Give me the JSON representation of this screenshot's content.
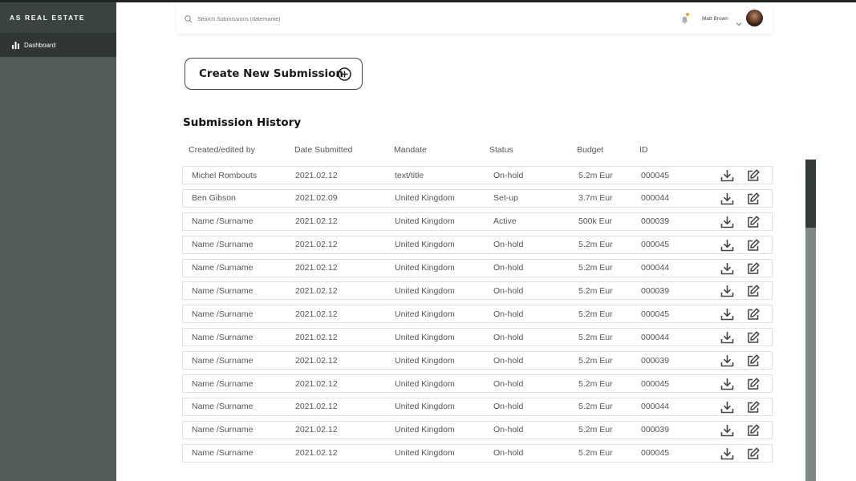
{
  "sidebar": {
    "brand": "AS REAL ESTATE",
    "items": [
      {
        "label": "Dashboard",
        "icon": "bar-chart-icon"
      }
    ]
  },
  "header": {
    "search_placeholder": "Search Submissions (date/name)",
    "user_name": "Matt Brown",
    "notification_dot_color": "#f0a030"
  },
  "main": {
    "create_button_label": "Create New Submission",
    "section_title": "Submission History",
    "columns": [
      "Created/edited by",
      "Date Submitted",
      "Mandate",
      "Status",
      "Budget",
      "ID"
    ],
    "rows": [
      [
        "Michel Rombouts",
        "2021.02.12",
        "text/title",
        "On-hold",
        "5.2m Eur",
        "000045"
      ],
      [
        "Ben Gibson",
        "2021.02.09",
        "United Kingdom",
        "Set-up",
        "3.7m Eur",
        "000044"
      ],
      [
        "Name /Surname",
        "2021.02.12",
        "United Kingdom",
        "Active",
        "500k Eur",
        "000039"
      ],
      [
        "Name /Surname",
        "2021.02.12",
        "United Kingdom",
        "On-hold",
        "5.2m Eur",
        "000045"
      ],
      [
        "Name /Surname",
        "2021.02.12",
        "United Kingdom",
        "On-hold",
        "5.2m Eur",
        "000044"
      ],
      [
        "Name /Surname",
        "2021.02.12",
        "United Kingdom",
        "On-hold",
        "5.2m Eur",
        "000039"
      ],
      [
        "Name /Surname",
        "2021.02.12",
        "United Kingdom",
        "On-hold",
        "5.2m Eur",
        "000045"
      ],
      [
        "Name /Surname",
        "2021.02.12",
        "United Kingdom",
        "On-hold",
        "5.2m Eur",
        "000044"
      ],
      [
        "Name /Surname",
        "2021.02.12",
        "United Kingdom",
        "On-hold",
        "5.2m Eur",
        "000039"
      ],
      [
        "Name /Surname",
        "2021.02.12",
        "United Kingdom",
        "On-hold",
        "5.2m Eur",
        "000045"
      ],
      [
        "Name /Surname",
        "2021.02.12",
        "United Kingdom",
        "On-hold",
        "5.2m Eur",
        "000044"
      ],
      [
        "Name /Surname",
        "2021.02.12",
        "United Kingdom",
        "On-hold",
        "5.2m Eur",
        "000039"
      ],
      [
        "Name /Surname",
        "2021.02.12",
        "United Kingdom",
        "On-hold",
        "5.2m Eur",
        "000045"
      ]
    ],
    "row_action_icons": [
      "download-icon",
      "edit-icon"
    ]
  }
}
